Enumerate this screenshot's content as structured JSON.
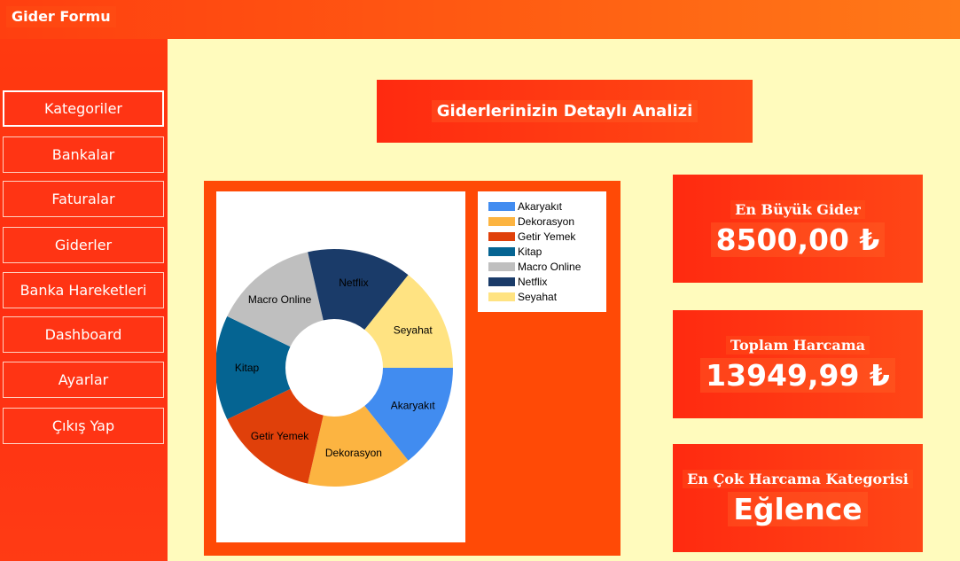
{
  "window": {
    "title": "Gider Formu"
  },
  "sidebar": {
    "items": [
      {
        "label": "Kategoriler"
      },
      {
        "label": "Bankalar"
      },
      {
        "label": "Faturalar"
      },
      {
        "label": "Giderler"
      },
      {
        "label": "Banka Hareketleri"
      },
      {
        "label": "Dashboard"
      },
      {
        "label": "Ayarlar"
      },
      {
        "label": "Çıkış Yap"
      }
    ]
  },
  "main": {
    "heading": "Giderlerinizin Detaylı Analizi",
    "cards": [
      {
        "label": "En Büyük Gider",
        "value": "8500,00 ₺"
      },
      {
        "label": "Toplam Harcama",
        "value": "13949,99 ₺"
      },
      {
        "label": "En Çok Harcama Kategorisi",
        "value": "Eğlence"
      }
    ]
  },
  "chart_data": {
    "type": "pie",
    "style": "doughnut",
    "legend_position": "top-right",
    "categories": [
      "Akaryakıt",
      "Dekorasyon",
      "Getir Yemek",
      "Kitap",
      "Macro Online",
      "Netflix",
      "Seyahat"
    ],
    "values": [
      1,
      1,
      1,
      1,
      1,
      1,
      1
    ],
    "colors": [
      "#418cf0",
      "#fcb441",
      "#e0400a",
      "#056492",
      "#bfbfbf",
      "#1a3b69",
      "#ffe382"
    ]
  }
}
